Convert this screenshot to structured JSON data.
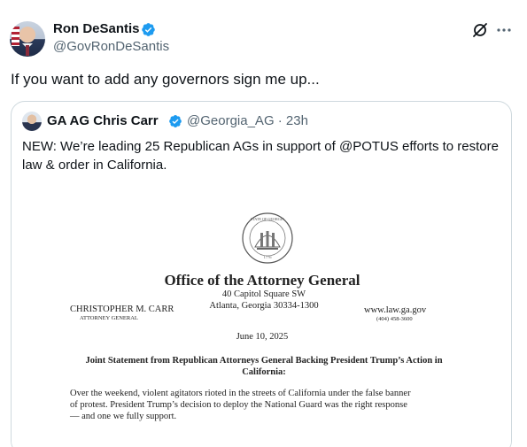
{
  "post": {
    "author": {
      "display_name": "Ron DeSantis",
      "handle": "@GovRonDeSantis",
      "verified_color": "#1d9bf0"
    },
    "text": "If you want to add any governors sign me up...",
    "icons": [
      "grok-icon",
      "more-icon",
      "verified-badge-icon"
    ]
  },
  "quote": {
    "author": {
      "display_name": "GA AG Chris Carr",
      "handle_time": "@Georgia_AG · 23h"
    },
    "text": "NEW: We’re leading 25 Republican AGs in support of @POTUS efforts to restore law & order in California.",
    "letter": {
      "seal_text": "STATE OF GEORGIA",
      "seal_year": "1776",
      "office_title": "Office of the Attorney General",
      "address_1": "40 Capitol Square SW",
      "address_2": "Atlanta, Georgia 30334-1300",
      "name": "CHRISTOPHER M. CARR",
      "title": "ATTORNEY GENERAL",
      "website": "www.law.ga.gov",
      "phone": "(404) 458-3600",
      "date": "June 10, 2025",
      "heading": "Joint Statement from Republican Attorneys General Backing President Trump’s Action in California:",
      "body": [
        "Over the weekend, violent agitators rioted in the streets of California under the false banner",
        "of protest. President Trump’s decision to deploy the National Guard was the right response",
        "— and one we fully support."
      ]
    }
  }
}
